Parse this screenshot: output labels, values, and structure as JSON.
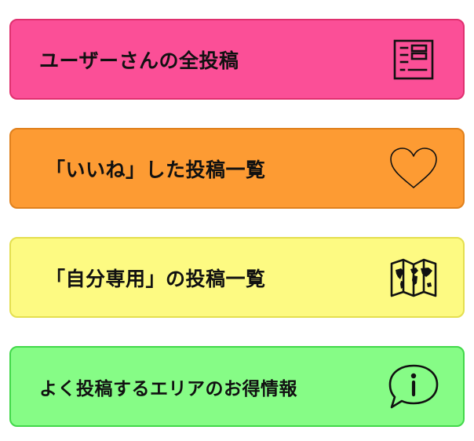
{
  "menu": {
    "items": [
      {
        "label": "ユーザーさんの全投稿",
        "icon": "document-list-icon"
      },
      {
        "label": "「いいね」した投稿一覧",
        "icon": "heart-icon"
      },
      {
        "label": "「自分専用」の投稿一覧",
        "icon": "world-map-icon"
      },
      {
        "label": "よく投稿するエリアのお得情報",
        "icon": "info-speech-bubble-icon"
      }
    ]
  },
  "colors": {
    "posts": "#fb4f97",
    "likes": "#fd9b33",
    "private": "#fdfa82",
    "deals": "#86fc86"
  }
}
